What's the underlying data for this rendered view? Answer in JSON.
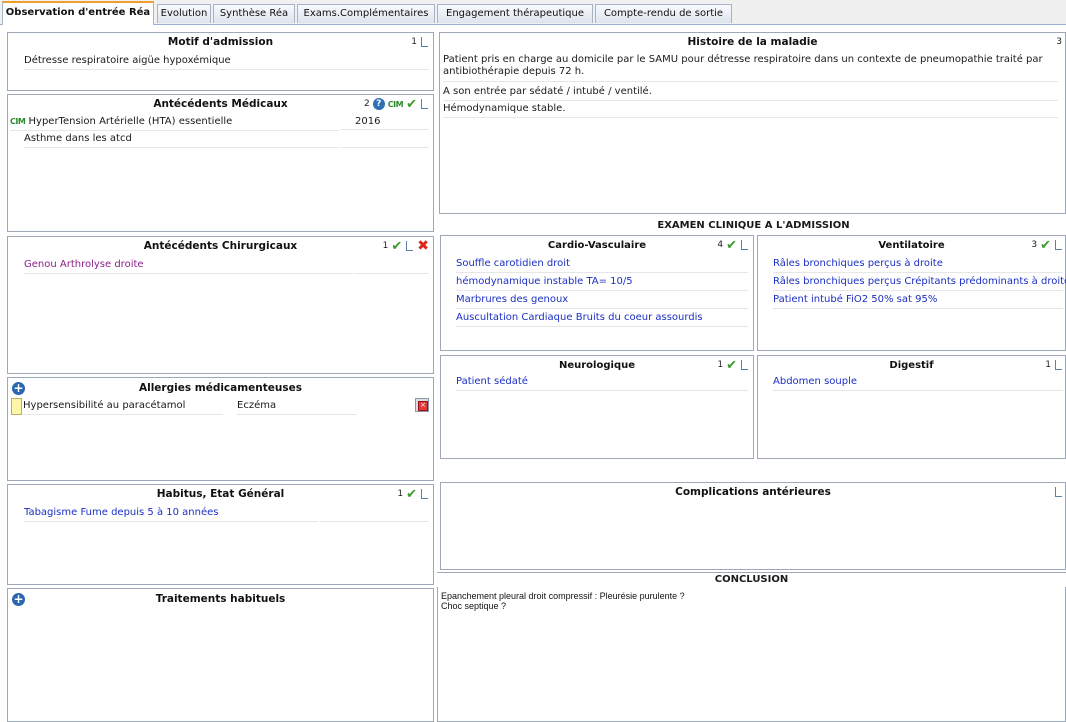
{
  "tabs": [
    {
      "label": "Observation d'entrée Réa",
      "active": true
    },
    {
      "label": "Evolution"
    },
    {
      "label": "Synthèse Réa"
    },
    {
      "label": "Exams.Complémentaires"
    },
    {
      "label": "Engagement thérapeutique"
    },
    {
      "label": "Compte-rendu de sortie"
    }
  ],
  "motif": {
    "title": "Motif d'admission",
    "count": "1",
    "rows": [
      "Détresse respiratoire aigüe hypoxémique"
    ]
  },
  "atcd_med": {
    "title": "Antécédents Médicaux",
    "count": "2",
    "rows": [
      {
        "label": "HyperTension Artérielle (HTA) essentielle",
        "year": "2016",
        "cim": "CIM"
      },
      {
        "label": "Asthme dans les atcd",
        "year": ""
      }
    ]
  },
  "atcd_chir": {
    "title": "Antécédents Chirurgicaux",
    "count": "1",
    "rows": [
      "Genou Arthrolyse droite"
    ]
  },
  "allergies": {
    "title": "Allergies médicamenteuses",
    "rows": [
      {
        "label": "Hypersensibilité au paracétamol",
        "reaction": "Eczéma"
      }
    ]
  },
  "habitus": {
    "title": "Habitus, Etat Général",
    "count": "1",
    "rows": [
      "Tabagisme Fume depuis 5 à 10 années"
    ]
  },
  "traitements": {
    "title": "Traitements habituels"
  },
  "histoire": {
    "title": "Histoire de la maladie",
    "count": "3",
    "rows": [
      "Patient pris en charge au domicile par le SAMU pour détresse respiratoire dans un contexte de pneumopathie traité par antibiothérapie depuis 72 h.",
      "A son entrée par sédaté / intubé / ventilé.",
      "Hémodynamique stable."
    ]
  },
  "examen_title": "EXAMEN CLINIQUE A L'ADMISSION",
  "cardio": {
    "title": "Cardio-Vasculaire",
    "count": "4",
    "rows": [
      "Souffle carotidien droit",
      "hémodynamique instable TA= 10/5",
      "Marbrures des genoux",
      "Auscultation Cardiaque Bruits du coeur assourdis"
    ]
  },
  "ventil": {
    "title": "Ventilatoire",
    "count": "3",
    "rows": [
      "Râles bronchiques perçus à droite",
      "Râles bronchiques perçus Crépitants prédominants à droite",
      "Patient intubé FiO2 50% sat 95%"
    ]
  },
  "neuro": {
    "title": "Neurologique",
    "count": "1",
    "rows": [
      "Patient sédaté"
    ]
  },
  "digestif": {
    "title": "Digestif",
    "count": "1",
    "rows": [
      "Abdomen souple"
    ]
  },
  "complications": {
    "title": "Complications antérieures"
  },
  "conclusion": {
    "title": "CONCLUSION",
    "text": "Epanchement pleural droit compressif : Pleurésie purulente ?\nChoc septique ?"
  },
  "colors": {
    "link_blue": "#1b2fc4",
    "surgery_purple": "#8a1f8a",
    "check_green": "#3a9a2a",
    "delete_red": "#e02418",
    "tab_accent": "#f0a030"
  }
}
